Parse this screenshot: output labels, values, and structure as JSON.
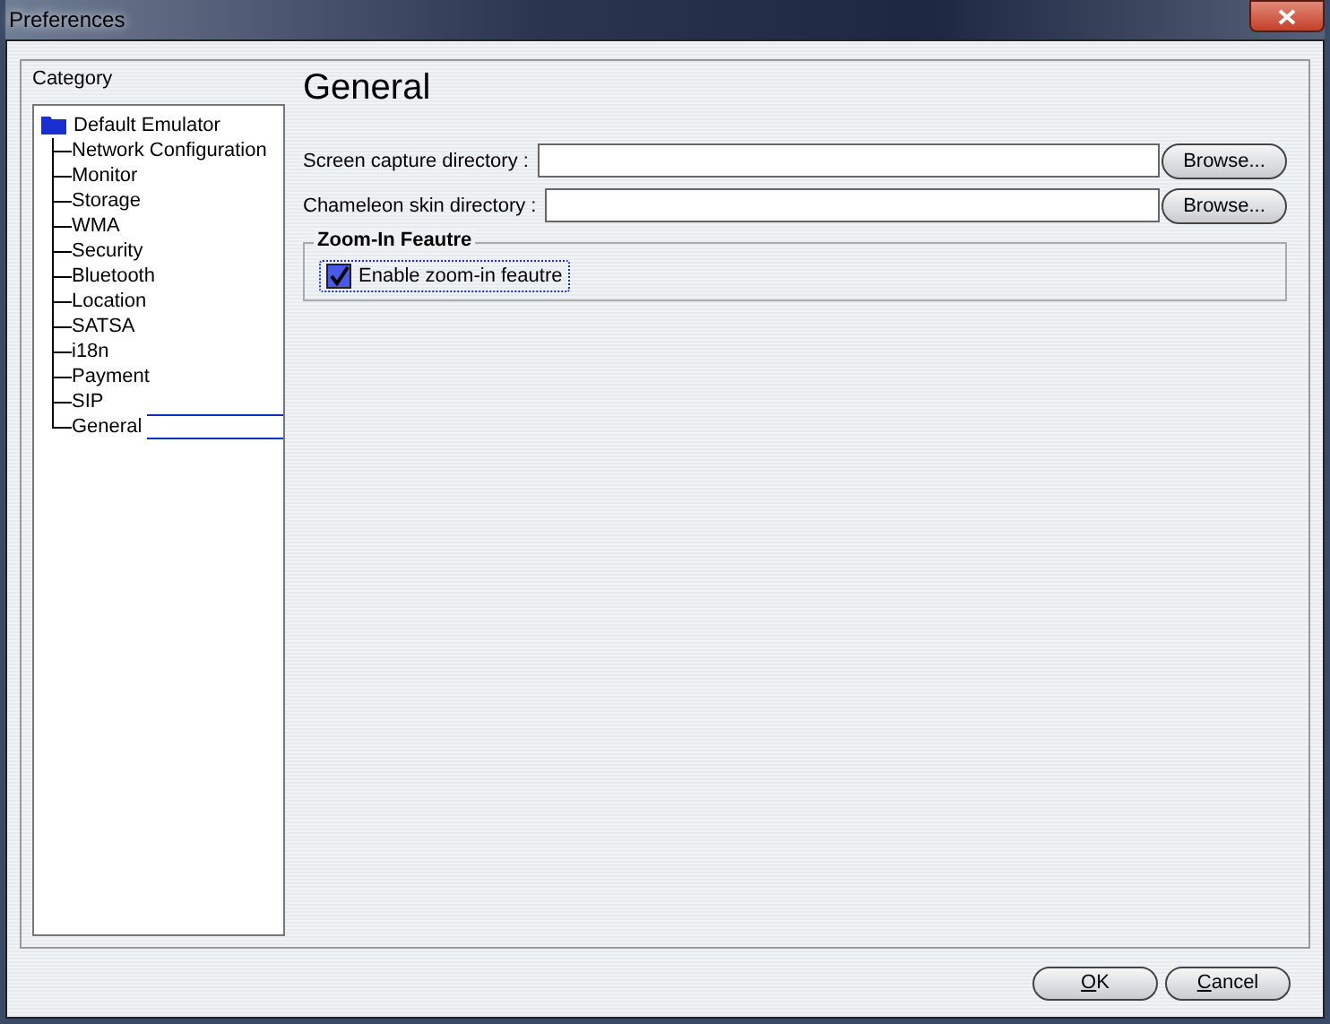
{
  "window": {
    "title": "Preferences"
  },
  "category": {
    "label": "Category",
    "tree": [
      {
        "label": "Default Emulator",
        "selected": false,
        "children": [
          {
            "label": "Network Configuration",
            "selected": false
          },
          {
            "label": "Monitor",
            "selected": false
          },
          {
            "label": "Storage",
            "selected": false
          },
          {
            "label": "WMA",
            "selected": false
          },
          {
            "label": "Security",
            "selected": false
          },
          {
            "label": "Bluetooth",
            "selected": false
          },
          {
            "label": "Location",
            "selected": false
          },
          {
            "label": "SATSA",
            "selected": false
          },
          {
            "label": "i18n",
            "selected": false
          },
          {
            "label": "Payment",
            "selected": false
          },
          {
            "label": "SIP",
            "selected": false
          },
          {
            "label": "General",
            "selected": true
          }
        ]
      }
    ]
  },
  "panel": {
    "heading": "General",
    "fields": [
      {
        "label": "Screen capture directory :",
        "button": "Browse..."
      },
      {
        "label": "Chameleon skin directory :",
        "button": "Browse..."
      }
    ],
    "group": {
      "title": "Zoom-In Feautre",
      "checkbox": {
        "label": "Enable zoom-in feautre",
        "checked": true
      }
    }
  },
  "buttons": [
    "OK",
    "Cancel"
  ]
}
